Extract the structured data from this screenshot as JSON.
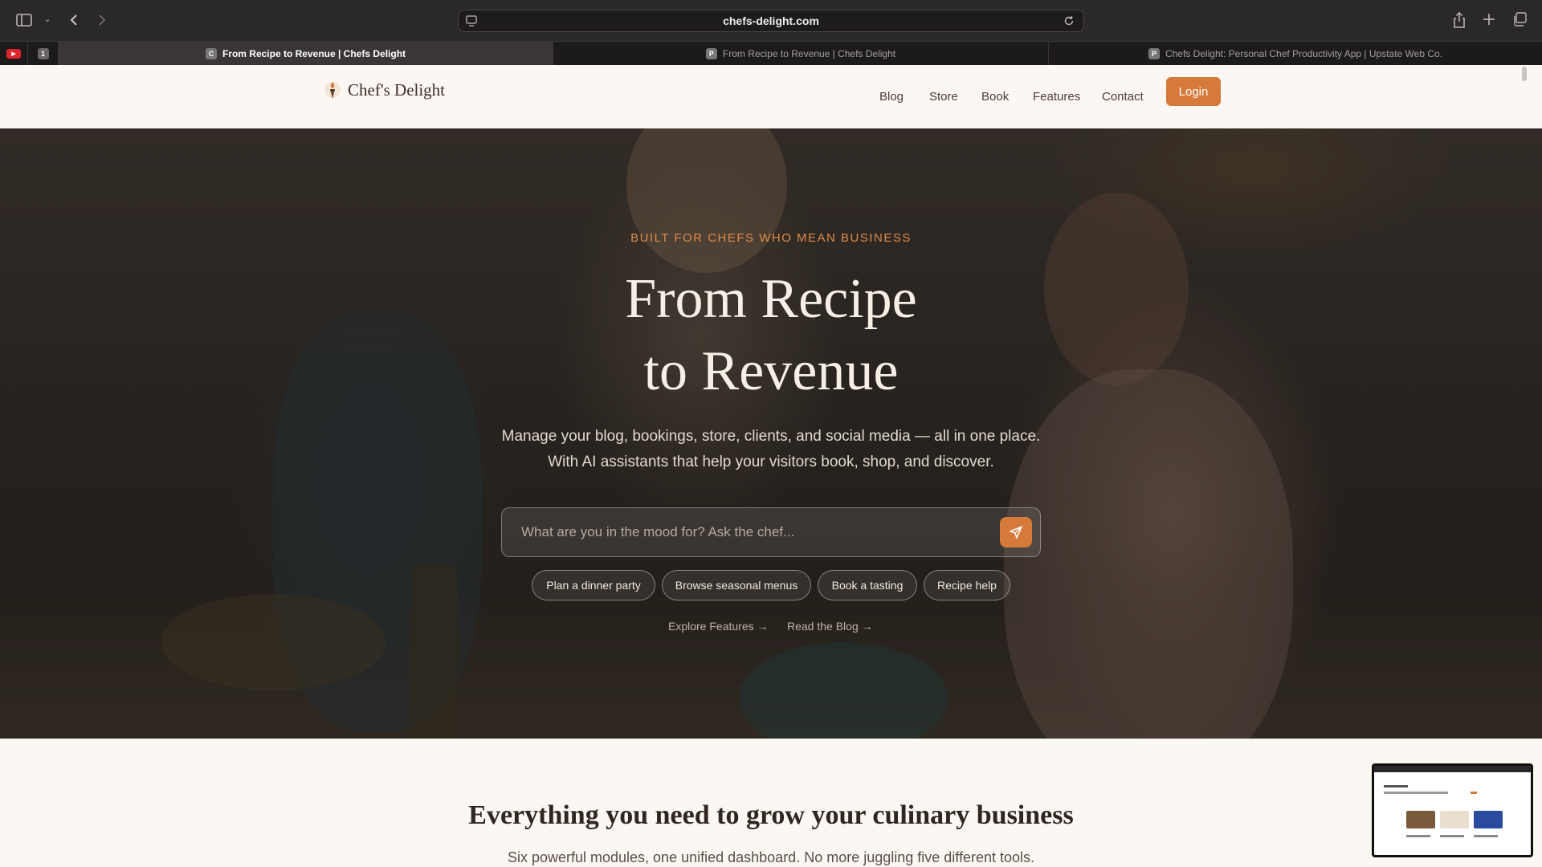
{
  "browser": {
    "url": "chefs-delight.com",
    "tab_count_badge": "1",
    "tabs": [
      {
        "favicon": "C",
        "title": "From Recipe to Revenue | Chefs Delight",
        "active": true
      },
      {
        "favicon": "P",
        "title": "From Recipe to Revenue | Chefs Delight",
        "active": false
      },
      {
        "favicon": "P",
        "title": "Chefs Delight: Personal Chef Productivity App | Upstate Web Co.",
        "active": false
      }
    ]
  },
  "site": {
    "brand": "Chef's Delight",
    "nav": [
      "Blog",
      "Store",
      "Book",
      "Features",
      "Contact"
    ],
    "login": "Login",
    "accent_color": "#d67a3c"
  },
  "hero": {
    "eyebrow": "BUILT FOR CHEFS WHO MEAN BUSINESS",
    "title_line1": "From Recipe",
    "title_line2": "to Revenue",
    "subtitle": "Manage your blog, bookings, store, clients, and social media — all in one place. With AI assistants that help your visitors book, shop, and discover.",
    "ask_placeholder": "What are you in the mood for? Ask the chef...",
    "chips": [
      "Plan a dinner party",
      "Browse seasonal menus",
      "Book a tasting",
      "Recipe help"
    ],
    "links": [
      "Explore Features →",
      "Read the Blog →"
    ]
  },
  "features": {
    "title": "Everything you need to grow your culinary business",
    "subtitle": "Six powerful modules, one unified dashboard. No more juggling five different tools."
  }
}
